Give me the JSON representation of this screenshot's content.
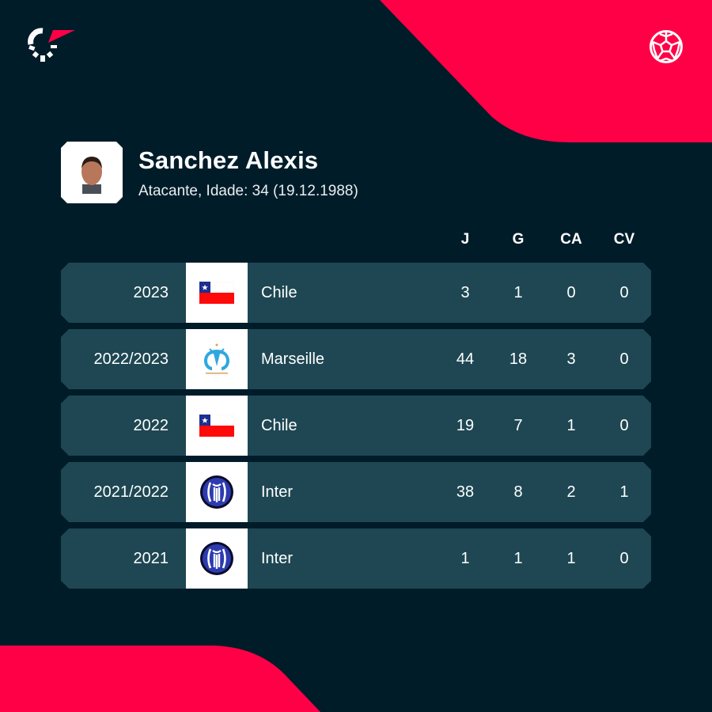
{
  "brand": {
    "logo_icon": "flashscore-logo-icon",
    "sport_icon": "soccer-ball-icon",
    "accent_color": "#ff0046",
    "background_color": "#011c29",
    "row_color": "#1e4753"
  },
  "player": {
    "name": "Sanchez Alexis",
    "subtitle": "Atacante, Idade: 34 (19.12.1988)",
    "photo": "player-photo"
  },
  "table": {
    "headers": {
      "j": "J",
      "g": "G",
      "ca": "CA",
      "cv": "CV"
    },
    "rows": [
      {
        "season": "2023",
        "team": "Chile",
        "badge": "chile-flag-icon",
        "j": "3",
        "g": "1",
        "ca": "0",
        "cv": "0"
      },
      {
        "season": "2022/2023",
        "team": "Marseille",
        "badge": "marseille-crest-icon",
        "j": "44",
        "g": "18",
        "ca": "3",
        "cv": "0"
      },
      {
        "season": "2022",
        "team": "Chile",
        "badge": "chile-flag-icon",
        "j": "19",
        "g": "7",
        "ca": "1",
        "cv": "0"
      },
      {
        "season": "2021/2022",
        "team": "Inter",
        "badge": "inter-crest-icon",
        "j": "38",
        "g": "8",
        "ca": "2",
        "cv": "1"
      },
      {
        "season": "2021",
        "team": "Inter",
        "badge": "inter-crest-icon",
        "j": "1",
        "g": "1",
        "ca": "1",
        "cv": "0"
      }
    ]
  }
}
